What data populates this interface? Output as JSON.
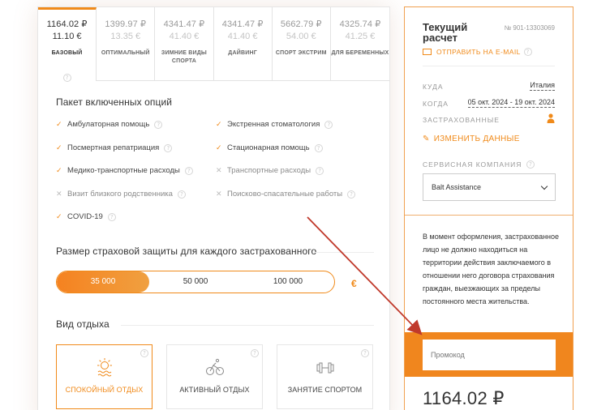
{
  "plans": [
    {
      "price_rub": "1164.02 ₽",
      "price_eur": "11.10 €",
      "name": "БАЗОВЫЙ",
      "active": true
    },
    {
      "price_rub": "1399.97 ₽",
      "price_eur": "13.35 €",
      "name": "ОПТИМАЛЬНЫЙ",
      "active": false
    },
    {
      "price_rub": "4341.47 ₽",
      "price_eur": "41.40 €",
      "name": "ЗИМНИЕ ВИДЫ СПОРТА",
      "active": false
    },
    {
      "price_rub": "4341.47 ₽",
      "price_eur": "41.40 €",
      "name": "ДАЙВИНГ",
      "active": false
    },
    {
      "price_rub": "5662.79 ₽",
      "price_eur": "54.00 €",
      "name": "СПОРТ ЭКСТРИМ",
      "active": false
    },
    {
      "price_rub": "4325.74 ₽",
      "price_eur": "41.25 €",
      "name": "ДЛЯ БЕРЕМЕННЫХ",
      "active": false
    }
  ],
  "options_title": "Пакет включенных опций",
  "options": [
    {
      "label": "Амбулаторная помощь",
      "included": true
    },
    {
      "label": "Экстренная стоматология",
      "included": true
    },
    {
      "label": "Посмертная репатриация",
      "included": true
    },
    {
      "label": "Стационарная помощь",
      "included": true
    },
    {
      "label": "Медико-транспортные расходы",
      "included": true
    },
    {
      "label": "Транспортные расходы",
      "included": false
    },
    {
      "label": "Визит близкого родственника",
      "included": false
    },
    {
      "label": "Поисково-спасательные работы",
      "included": false
    },
    {
      "label": "COVID-19",
      "included": true
    }
  ],
  "coverage_title": "Размер страховой защиты для каждого застрахованного",
  "coverage": [
    "35 000",
    "50 000",
    "100 000"
  ],
  "currency": "€",
  "rest_title": "Вид отдыха",
  "rest_types": [
    {
      "label": "СПОКОЙНЫЙ ОТДЫХ",
      "icon": "sun-icon",
      "active": true
    },
    {
      "label": "АКТИВНЫЙ ОТДЫХ",
      "icon": "bicycle-icon",
      "active": false
    },
    {
      "label": "ЗАНЯТИЕ СПОРТОМ",
      "icon": "dumbbell-icon",
      "active": false
    }
  ],
  "calc": {
    "title": "Текущий расчет",
    "number": "№ 901-13303069",
    "email_link": "ОТПРАВИТЬ НА E-MAIL",
    "where_label": "КУДА",
    "where_value": "Италия",
    "when_label": "КОГДА",
    "when_value": "05 окт. 2024 - 19 окт. 2024",
    "insured_label": "ЗАСТРАХОВАННЫЕ",
    "edit_link": "ИЗМЕНИТЬ ДАННЫЕ",
    "service_label": "СЕРВИСНАЯ КОМПАНИЯ",
    "service_value": "Balt Assistance",
    "notice": "В момент оформления, застрахованное лицо не должно находиться на территории действия заключаемого в отношении него договора страхования граждан, выезжающих за пределы постоянного места жительства.",
    "promo_placeholder": "Промокод",
    "total": "1164.02 ₽"
  },
  "colors": {
    "accent": "#f08a1a",
    "annotation_arrow": "#c0392b"
  }
}
